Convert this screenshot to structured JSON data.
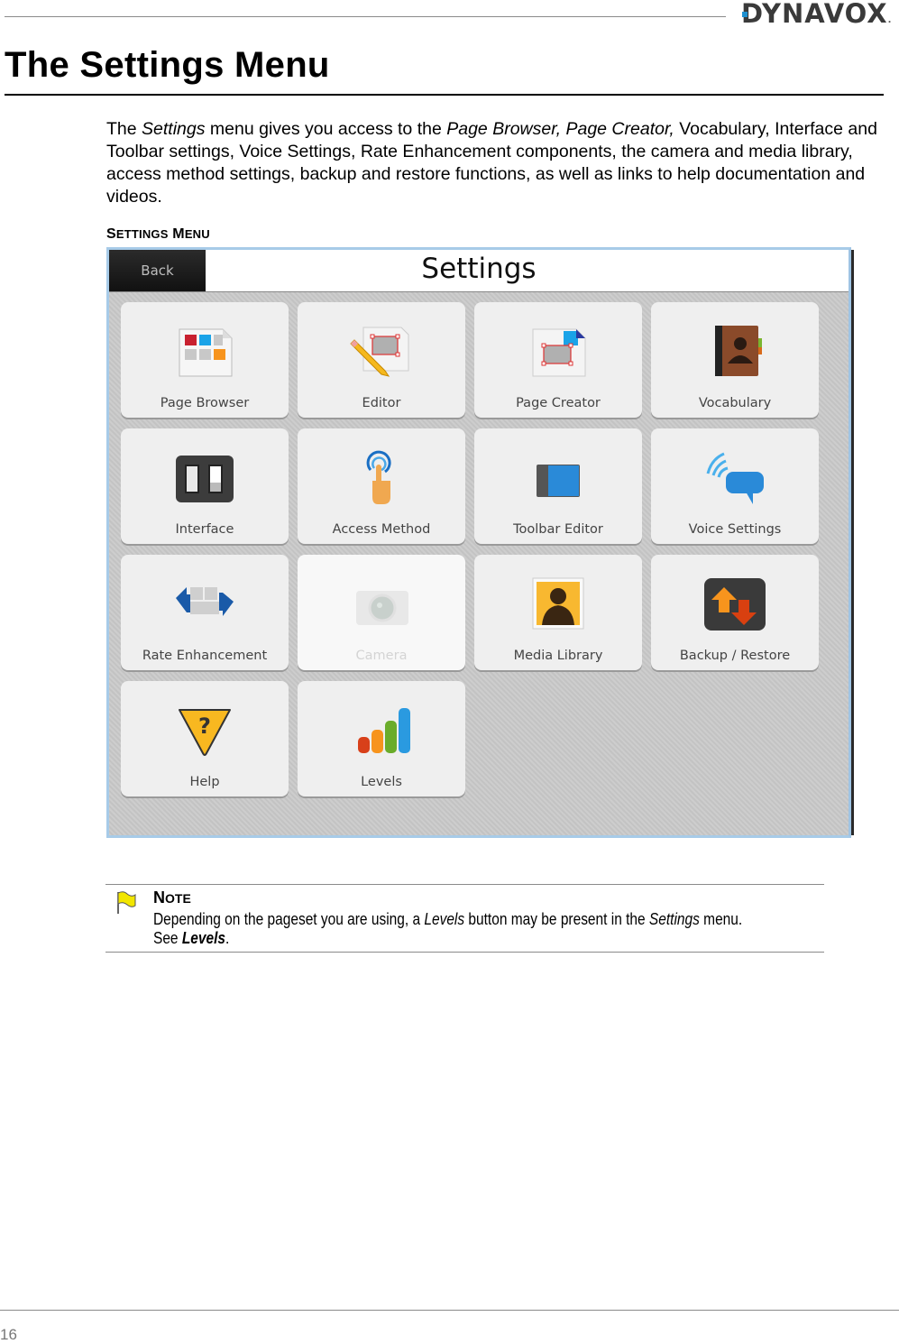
{
  "header": {
    "logo_text": "DYNAVOX",
    "logo_suffix": "."
  },
  "page": {
    "title": "The Settings Menu",
    "intro": {
      "p1": "The ",
      "settings_italic": "Settings",
      "p2": " menu gives you access to the ",
      "pages_italic": "Page Browser, Page Creator,",
      "p3": " Vocabulary, Interface and Toolbar settings, Voice Settings, Rate Enhancement components, the camera and media library, access method settings, backup and restore functions, as well as links to help documentation and videos."
    },
    "figure_caption": {
      "first_cap": "S",
      "first_rest": "ETTINGS",
      "second_cap": "M",
      "second_rest": "ENU"
    },
    "page_number": "16"
  },
  "settings_screen": {
    "back_label": "Back",
    "title": "Settings",
    "tiles": [
      {
        "label": "Page Browser",
        "icon": "page-browser-icon",
        "enabled": true
      },
      {
        "label": "Editor",
        "icon": "editor-icon",
        "enabled": true
      },
      {
        "label": "Page Creator",
        "icon": "page-creator-icon",
        "enabled": true
      },
      {
        "label": "Vocabulary",
        "icon": "vocabulary-icon",
        "enabled": true
      },
      {
        "label": "Interface",
        "icon": "interface-icon",
        "enabled": true
      },
      {
        "label": "Access Method",
        "icon": "access-method-icon",
        "enabled": true
      },
      {
        "label": "Toolbar Editor",
        "icon": "toolbar-editor-icon",
        "enabled": true
      },
      {
        "label": "Voice Settings",
        "icon": "voice-settings-icon",
        "enabled": true
      },
      {
        "label": "Rate Enhancement",
        "icon": "rate-enhancement-icon",
        "enabled": true
      },
      {
        "label": "Camera",
        "icon": "camera-icon",
        "enabled": false
      },
      {
        "label": "Media Library",
        "icon": "media-library-icon",
        "enabled": true
      },
      {
        "label": "Backup / Restore",
        "icon": "backup-restore-icon",
        "enabled": true
      },
      {
        "label": "Help",
        "icon": "help-icon",
        "enabled": true
      },
      {
        "label": "Levels",
        "icon": "levels-icon",
        "enabled": true
      }
    ]
  },
  "note": {
    "heading_cap": "N",
    "heading_rest": "OTE",
    "t1": "Depending on the pageset you are using, a ",
    "levels_italic": "Levels",
    "t2": " button may be present in the ",
    "settings_italic": "Settings",
    "t3": " menu.",
    "t4": "See ",
    "link": "Levels",
    "t5": "."
  },
  "colors": {
    "accent_blue": "#1e90d0",
    "screenshot_border": "#a7cbe8",
    "tile_bg": "#efefef"
  }
}
